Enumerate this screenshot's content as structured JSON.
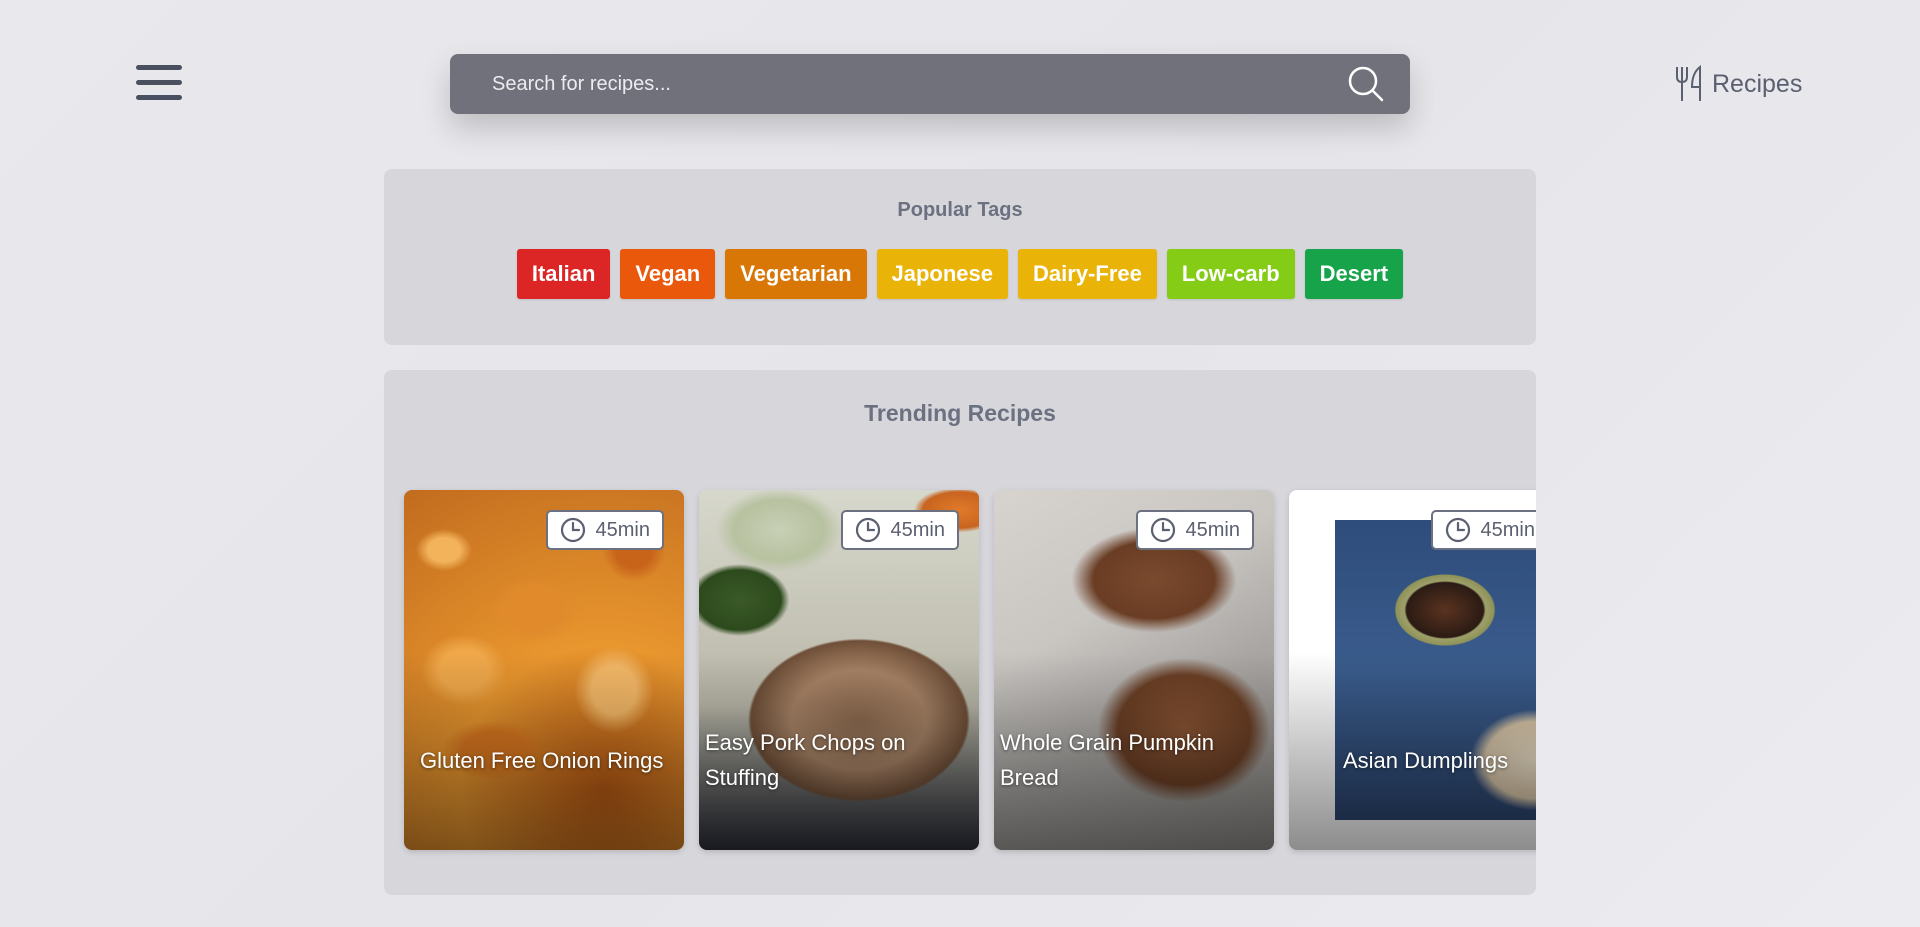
{
  "header": {
    "search_placeholder": "Search for recipes...",
    "brand_label": "Recipes"
  },
  "popular_tags": {
    "title": "Popular Tags",
    "tags": [
      {
        "label": "Italian",
        "color": "#dc2626"
      },
      {
        "label": "Vegan",
        "color": "#ea580c"
      },
      {
        "label": "Vegetarian",
        "color": "#d97706"
      },
      {
        "label": "Japonese",
        "color": "#eab308"
      },
      {
        "label": "Dairy-Free",
        "color": "#eab308"
      },
      {
        "label": "Low-carb",
        "color": "#84cc16"
      },
      {
        "label": "Desert",
        "color": "#16a34a"
      }
    ]
  },
  "trending": {
    "title": "Trending Recipes",
    "recipes": [
      {
        "title": "Gluten Free Onion Rings",
        "time": "45min"
      },
      {
        "title": "Easy Pork Chops on Stuffing",
        "time": "45min"
      },
      {
        "title": "Whole Grain Pumpkin Bread",
        "time": "45min"
      },
      {
        "title": "Asian Dumplings",
        "time": "45min"
      }
    ]
  },
  "icons": {
    "menu": "hamburger-menu-icon",
    "search": "search-icon",
    "brand": "fork-knife-icon",
    "time": "clock-icon"
  },
  "colors": {
    "search_bg": "#70717b",
    "panel_bg": "#d6d6db",
    "text_muted": "#6b7180"
  }
}
